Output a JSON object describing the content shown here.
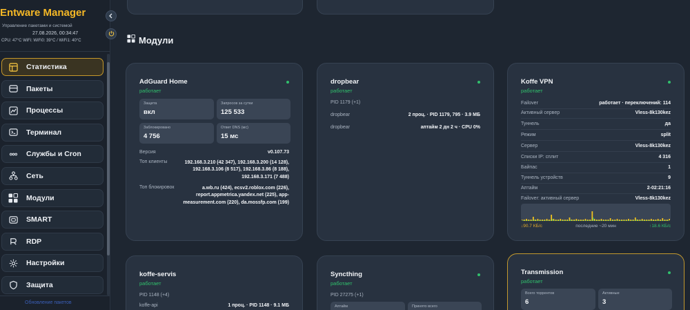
{
  "sidebar": {
    "title": "Entware Manager",
    "subtitle": "Управление пакетами и системой",
    "datetime": "27.08.2026, 00:34:47",
    "stats": "CPU: 47°C   WiFi: WiFi0: 39°C / WiFi1: 40°C",
    "items": [
      {
        "label": "Статистика",
        "icon": "dashboard-icon"
      },
      {
        "label": "Пакеты",
        "icon": "package-icon"
      },
      {
        "label": "Процессы",
        "icon": "activity-icon"
      },
      {
        "label": "Терминал",
        "icon": "terminal-icon"
      },
      {
        "label": "Службы и Cron",
        "icon": "dots-icon"
      },
      {
        "label": "Сеть",
        "icon": "network-icon"
      },
      {
        "label": "Модули",
        "icon": "modules-icon"
      },
      {
        "label": "SMART",
        "icon": "drive-icon"
      },
      {
        "label": "RDP",
        "icon": "rdp-icon"
      },
      {
        "label": "Настройки",
        "icon": "gear-icon"
      },
      {
        "label": "Защита",
        "icon": "shield-icon"
      }
    ],
    "bottom_link": "Обновление пакетов"
  },
  "main": {
    "section_title": "Модули",
    "cards": {
      "adguard": {
        "title": "AdGuard Home",
        "status": "работает",
        "tiles": [
          {
            "label": "Защита",
            "value": "вкл"
          },
          {
            "label": "Запросов за сутки",
            "value": "125 533"
          },
          {
            "label": "Заблокировано",
            "value": "4 756"
          },
          {
            "label": "Ответ DNS (мс)",
            "value": "15 мс"
          }
        ],
        "version_label": "Версия",
        "version_value": "v0.107.73",
        "top_clients_label": "Топ клиенты",
        "top_clients_value": "192.168.3.210 (42 347), 192.168.3.200 (14 128), 192.168.3.106 (8 517), 192.168.3.86 (8 188), 192.168.3.171 (7 488)",
        "top_blocked_label": "Топ блокировок",
        "top_blocked_value": "a.wb.ru (424), ecsv2.roblox.com (226), report.appmetrica.yandex.net (225), app-measurement.com (220), da.mossfp.com (199)"
      },
      "dropbear": {
        "title": "dropbear",
        "status": "работает",
        "pid": "PID 1179 (+1)",
        "rows": [
          {
            "k": "dropbear",
            "v": "2 проц. · PID 1179, 795 · 3.9 МБ"
          },
          {
            "k": "dropbear",
            "v": "аптайм 2 дн 2 ч · CPU 0%"
          }
        ]
      },
      "koffe_vpn": {
        "title": "Koffe VPN",
        "status": "работает",
        "rows": [
          {
            "k": "Failover",
            "v": "работает · переключений: 114"
          },
          {
            "k": "Активный сервер",
            "v": "Vless-8k130kez"
          },
          {
            "k": "Туннель",
            "v": "да"
          },
          {
            "k": "Режим",
            "v": "split"
          },
          {
            "k": "Сервер",
            "v": "Vless-8k130kez"
          },
          {
            "k": "Списки IP: сплит",
            "v": "4 316"
          },
          {
            "k": "Байпас",
            "v": "1"
          },
          {
            "k": "Туннель устройств",
            "v": "9"
          },
          {
            "k": "Аптайм",
            "v": "2-02:21:16"
          },
          {
            "k": "Failover: активный сервер",
            "v": "Vless-8k130kez"
          }
        ],
        "legend_left": "↓90.7 КБ/с",
        "legend_mid": "последние ~20 мин",
        "legend_right": "↑18.6 КБ/с",
        "graph_colors": {
          "down": "#f0c21f",
          "up": "#2fbf6a"
        }
      },
      "koffe_servis": {
        "title": "koffe-servis",
        "status": "работает",
        "pid": "PID 1148 (+4)",
        "row": {
          "k": "koffe-api",
          "v": "1 проц. · PID 1148 · 9.1 МБ"
        }
      },
      "syncthing": {
        "title": "Syncthing",
        "status": "работает",
        "pid": "PID 27275 (+1)",
        "tiles": [
          {
            "label": "Аптайм"
          },
          {
            "label": "Принято всего"
          }
        ]
      },
      "transmission": {
        "title": "Transmission",
        "status": "работает",
        "tiles": [
          {
            "label": "Всего торрентов",
            "value": "6"
          },
          {
            "label": "Активные",
            "value": "3"
          }
        ]
      }
    }
  }
}
